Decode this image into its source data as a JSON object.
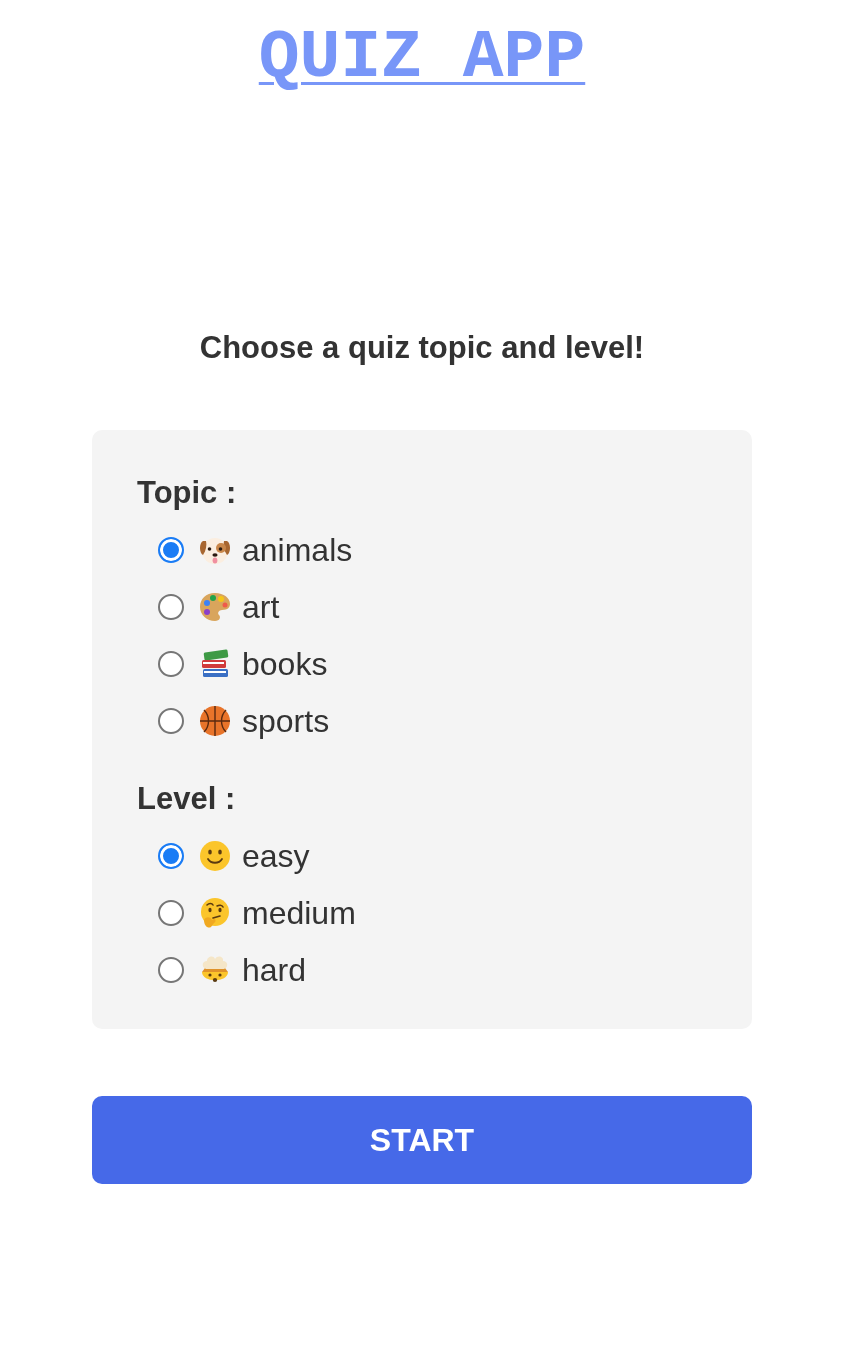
{
  "title": "QUIZ APP",
  "prompt": "Choose a quiz topic and level!",
  "groups": [
    {
      "label": "Topic :",
      "options": [
        {
          "label": "animals",
          "selected": true
        },
        {
          "label": "art",
          "selected": false
        },
        {
          "label": "books",
          "selected": false
        },
        {
          "label": "sports",
          "selected": false
        }
      ]
    },
    {
      "label": "Level :",
      "options": [
        {
          "label": "easy",
          "selected": true
        },
        {
          "label": "medium",
          "selected": false
        },
        {
          "label": "hard",
          "selected": false
        }
      ]
    }
  ],
  "start_button": "START"
}
